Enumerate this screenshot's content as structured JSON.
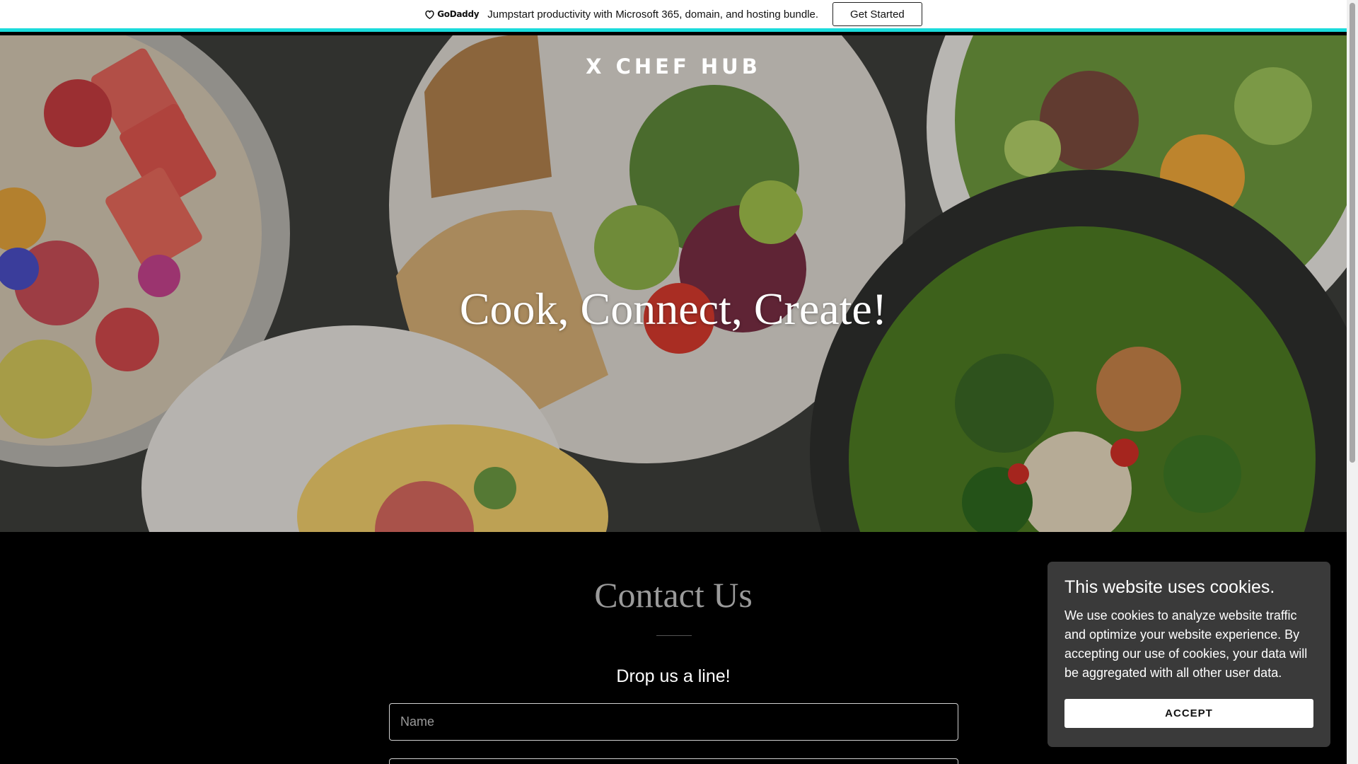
{
  "promo": {
    "brand": "GoDaddy",
    "message": "Jumpstart productivity with Microsoft 365, domain, and hosting bundle.",
    "cta_label": "Get Started"
  },
  "hero": {
    "site_title": "X CHEF HUB",
    "heading": "Cook, Connect, Create!"
  },
  "contact": {
    "title": "Contact Us",
    "subtitle": "Drop us a line!",
    "name_placeholder": "Name",
    "email_placeholder": ""
  },
  "cookie": {
    "title": "This website uses cookies.",
    "text": "We use cookies to analyze website traffic and optimize your website experience. By accepting our use of cookies, your data will be aggregated with all other user data.",
    "accept_label": "ACCEPT"
  },
  "colors": {
    "accent_bar": "#1bdbdb",
    "page_background": "#000000",
    "cookie_panel": "#3a3a3a"
  }
}
